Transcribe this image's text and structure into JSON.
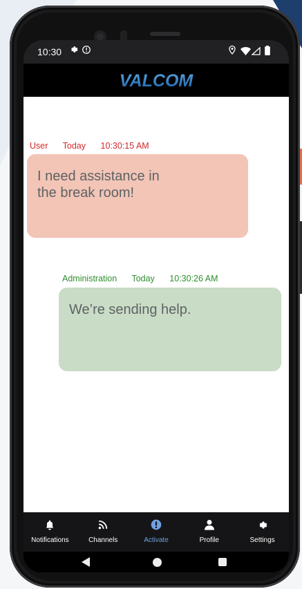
{
  "status_bar": {
    "time": "10:30",
    "icons_left": [
      "gear-icon",
      "alert-circle-icon"
    ],
    "icons_right": [
      "location-icon",
      "wifi-icon",
      "signal-icon",
      "battery-icon"
    ]
  },
  "app_bar": {
    "logo_text": "VALCOM"
  },
  "messages": [
    {
      "sender": "User",
      "date": "Today",
      "time": "10:30:15 AM",
      "text": "I need assistance in the break room!",
      "color": "#d12a2a",
      "bubble_color": "#f2c5b6"
    },
    {
      "sender": "Administration",
      "date": "Today",
      "time": "10:30:26 AM",
      "text": "We’re sending help.",
      "color": "#2f8d2f",
      "bubble_color": "#c9dcc5"
    }
  ],
  "bottom_nav": {
    "items": [
      {
        "label": "Notifications",
        "icon": "bell-icon",
        "active": false
      },
      {
        "label": "Channels",
        "icon": "rss-icon",
        "active": false
      },
      {
        "label": "Activate",
        "icon": "alert-icon",
        "active": true
      },
      {
        "label": "Profile",
        "icon": "person-icon",
        "active": false
      },
      {
        "label": "Settings",
        "icon": "gear-icon",
        "active": false
      }
    ],
    "active_color": "#6fa1e0"
  },
  "system_nav": [
    "back-icon",
    "home-icon",
    "recents-icon"
  ]
}
